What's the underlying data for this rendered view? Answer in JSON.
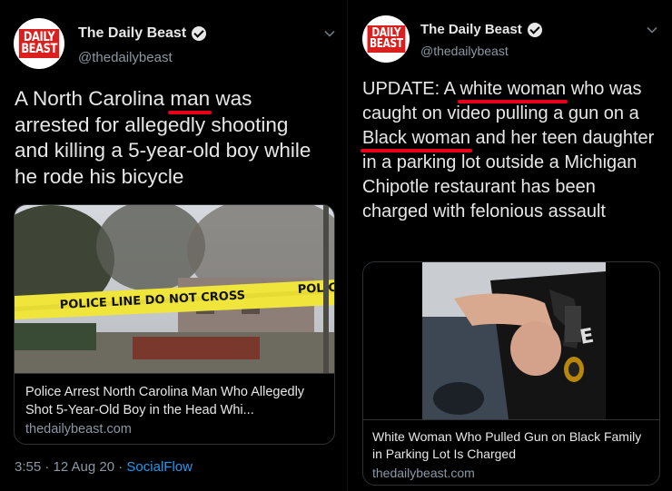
{
  "left_tweet": {
    "avatar_text": [
      "DAILY",
      "BEAST"
    ],
    "name": "The Daily Beast",
    "handle": "@thedailybeast",
    "text_parts": [
      "A North Carolina ",
      "man",
      " was arrested for allegedly shooting and killing a 5-year-old boy while he rode his bicycle"
    ],
    "card": {
      "tape_text": "POLICE LINE DO NOT CROSS",
      "tape_text_2": "POLIC",
      "title": "Police Arrest North Carolina Man Who Allegedly Shot 5-Year-Old Boy in the Head Whi...",
      "domain": "thedailybeast.com"
    },
    "time": "3:55 · 12 Aug 20 · ",
    "source": "SocialFlow"
  },
  "right_tweet": {
    "avatar_text": [
      "DAILY",
      "BEAST"
    ],
    "name": "The Daily Beast",
    "handle": "@thedailybeast",
    "text_parts": [
      "UPDATE: A ",
      "white woman",
      " who was caught on video pulling a gun on a ",
      "Black woman",
      " and her teen daughter in a parking lot outside a Michigan Chipotle restaurant has been charged with felonious assault"
    ],
    "card": {
      "title": "White Woman Who Pulled Gun on Black Family in Parking Lot Is Charged",
      "domain": "thedailybeast.com"
    }
  },
  "colors": {
    "background": "#000000",
    "text": "#e7e7e7",
    "secondary": "#8b98a5",
    "link": "#1d9bf0",
    "underline_red": "#e8001a",
    "logo_red": "#d9201e"
  }
}
